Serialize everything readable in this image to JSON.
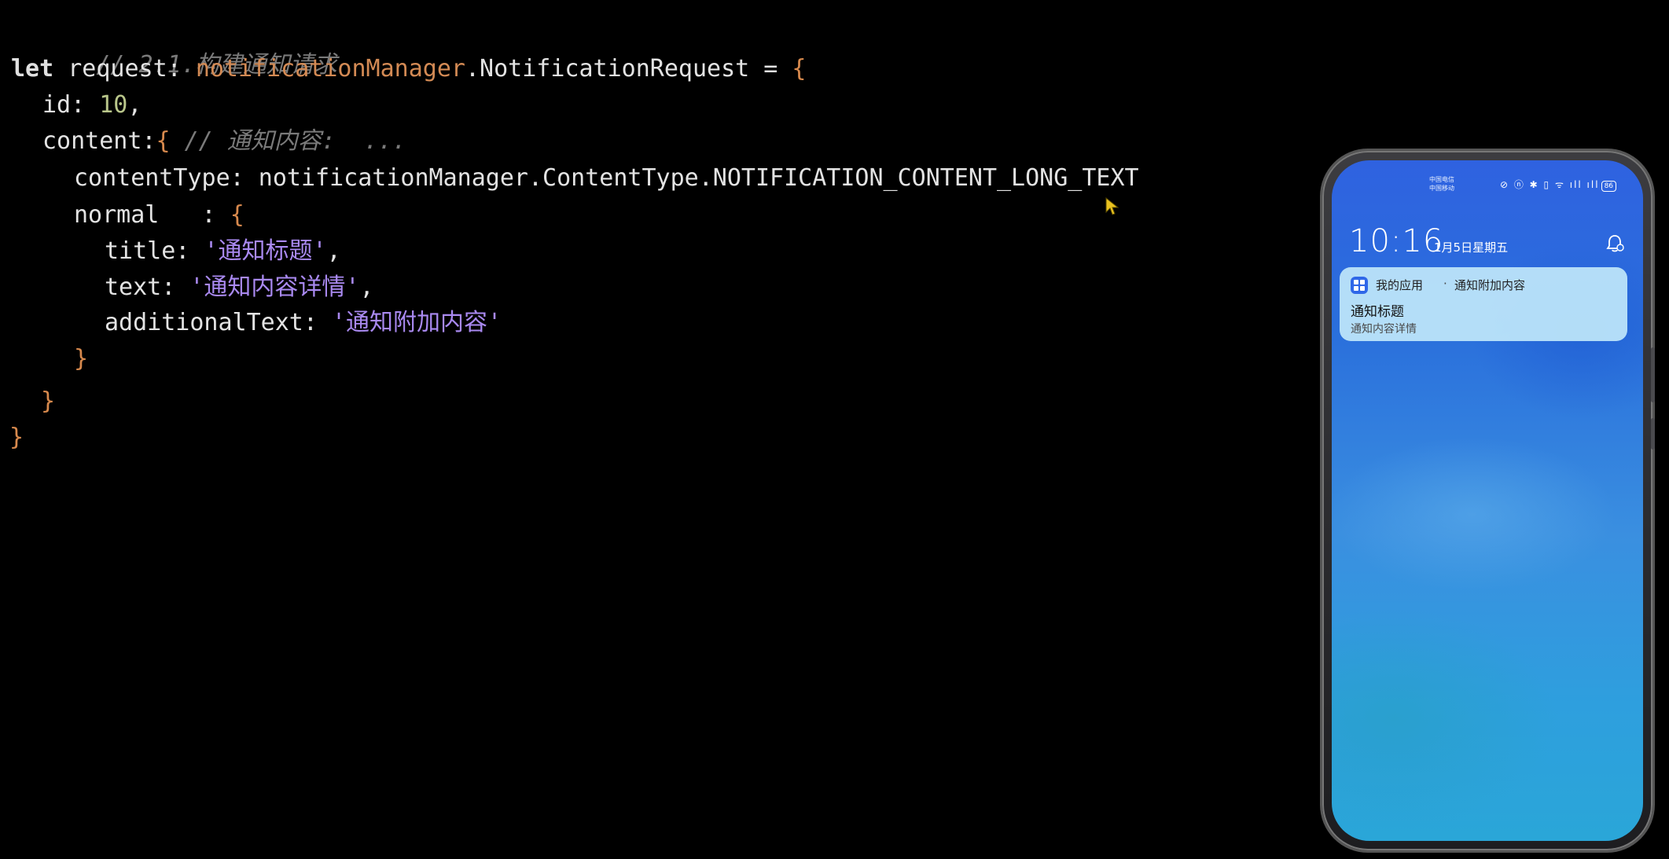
{
  "code": {
    "line1_comment": "// 2.1.构建通知请求",
    "line2_kw": "let",
    "line2_var": " request: ",
    "line2_obj": "notificationManager",
    "line2_type": ".NotificationRequest = ",
    "line2_brace": "{",
    "line3_key": "id: ",
    "line3_num": "10",
    "line3_tail": ",",
    "line4_key": "content:",
    "line4_brace": "{",
    "line4_comment": " // 通知内容:  ...",
    "line5_key": "contentType: notificationManager.ContentType.NOTIFICATION_CONTENT_LONG_TEXT",
    "line6_key": "normal   : ",
    "line6_brace": "{",
    "line7_key": "title: ",
    "line7_str": "'通知标题'",
    "line7_tail": ",",
    "line8_key": "text: ",
    "line8_str": "'通知内容详情'",
    "line8_tail": ",",
    "line9_key": "additionalText: ",
    "line9_str": "'通知附加内容'",
    "line10_brace": "}",
    "line11_brace": "}",
    "line12_brace": "}"
  },
  "phone": {
    "carrier_1": "中国电信",
    "carrier_2": "中国移动",
    "status_icons": "⊘ ⓝ ✱ ▯ ᯤ ıll ıll",
    "battery": "86",
    "time": "10:16",
    "date": "1月5日星期五",
    "bell_icon": "bell-icon",
    "notification": {
      "app_name": "我的应用",
      "separator": "·",
      "additional_text": "通知附加内容",
      "title": "通知标题",
      "text": "通知内容详情"
    }
  },
  "colors": {
    "background": "#000000",
    "comment": "#7a7a7a",
    "object": "#d38a54",
    "number": "#b9c68a",
    "string": "#a989f0",
    "brace": "#d7894d",
    "notification_card": "#bee6fa"
  }
}
